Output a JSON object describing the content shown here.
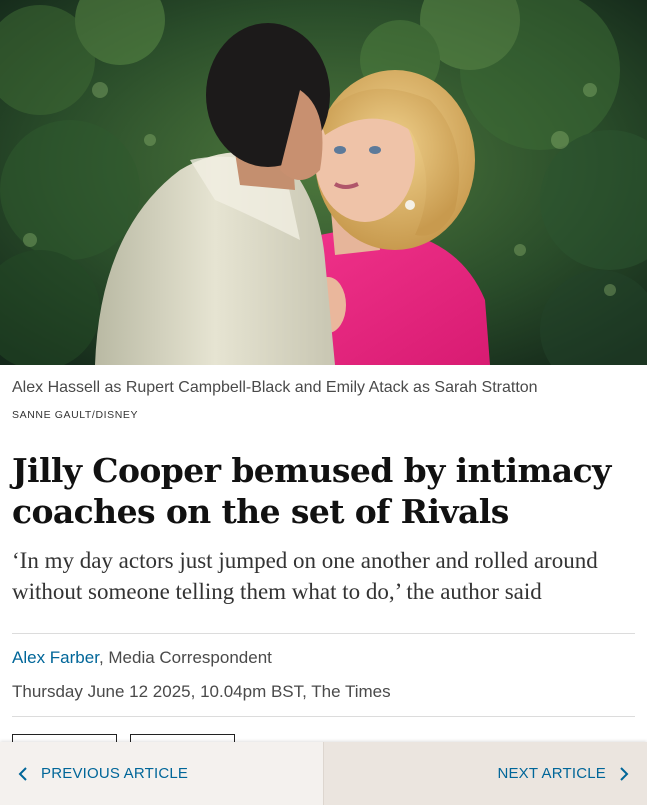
{
  "article": {
    "image_alt": "Alex Hassell and Emily Atack in a scene from Rivals",
    "caption": "Alex Hassell as Rupert Campbell-Black and Emily Atack as Sarah Stratton",
    "image_credit": "SANNE GAULT/DISNEY",
    "headline": "Jilly Cooper bemused by intimacy coaches on the set of Rivals",
    "standfirst": "‘In my day actors just jumped on one another and rolled around without someone telling them what to do,’ the author said",
    "author_name": "Alex Farber",
    "author_role": ", Media Correspondent",
    "dateline": "Thursday June 12 2025, 10.04pm BST, The Times"
  },
  "nav": {
    "previous_label": "PREVIOUS ARTICLE",
    "next_label": "NEXT ARTICLE",
    "previous_icon": "chevron-left-icon",
    "next_icon": "chevron-right-icon"
  },
  "colors": {
    "link": "#006699",
    "prev_bg": "#f4f1ee",
    "next_bg": "#ebe5df"
  }
}
